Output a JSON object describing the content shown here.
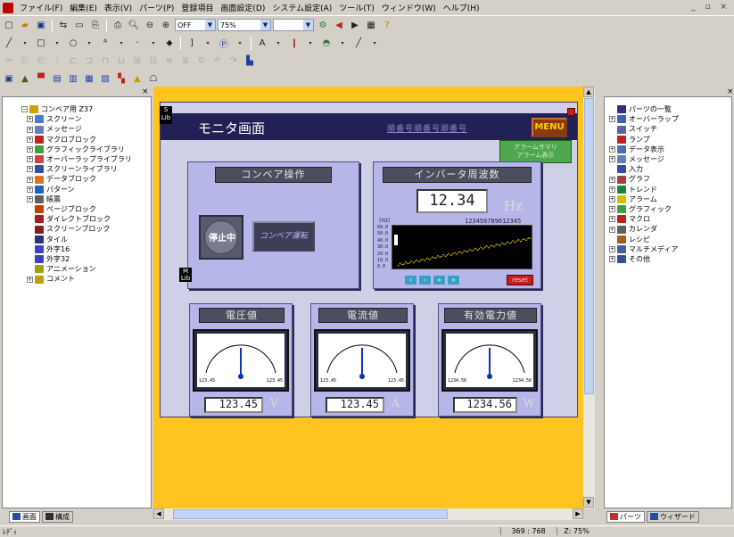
{
  "menu": {
    "items": [
      "ファイル(F)",
      "編集(E)",
      "表示(V)",
      "パーツ(P)",
      "登録項目",
      "画面設定(D)",
      "システム設定(A)",
      "ツール(T)",
      "ウィンドウ(W)",
      "ヘルプ(H)"
    ]
  },
  "toolbar": {
    "mode_label": "OFF",
    "zoom1": "75%",
    "zoom2": ""
  },
  "left_tree": {
    "root": "コンベア用 Z37",
    "items": [
      {
        "label": "スクリーン",
        "color": "#4a7ad0",
        "pm": "+"
      },
      {
        "label": "メッセージ",
        "color": "#6080c0",
        "pm": "+"
      },
      {
        "label": "マクロブロック",
        "color": "#c02020",
        "pm": "+"
      },
      {
        "label": "グラフィックライブラリ",
        "color": "#40a040",
        "pm": "+"
      },
      {
        "label": "オーバーラップライブラリ",
        "color": "#d04040",
        "pm": "+"
      },
      {
        "label": "スクリーンライブラリ",
        "color": "#3050a0",
        "pm": "+"
      },
      {
        "label": "データブロック",
        "color": "#e07020",
        "pm": "+"
      },
      {
        "label": "パターン",
        "color": "#2060c0",
        "pm": "+"
      },
      {
        "label": "帳票",
        "color": "#606060",
        "pm": "+"
      },
      {
        "label": "ページブロック",
        "color": "#c04000",
        "pm": ""
      },
      {
        "label": "ダイレクトブロック",
        "color": "#a02020",
        "pm": ""
      },
      {
        "label": "スクリーンブロック",
        "color": "#802020",
        "pm": ""
      },
      {
        "label": "タイル",
        "color": "#303080",
        "pm": ""
      },
      {
        "label": "外字16",
        "color": "#4040c0",
        "pm": ""
      },
      {
        "label": "外字32",
        "color": "#4040c0",
        "pm": ""
      },
      {
        "label": "アニメーション",
        "color": "#a0a000",
        "pm": ""
      },
      {
        "label": "コメント",
        "color": "#c0a000",
        "pm": "+"
      }
    ]
  },
  "left_tabs": {
    "tab1": "画面",
    "tab2": "構成"
  },
  "right_tree": {
    "items": [
      {
        "label": "パーツの一覧",
        "color": "#303080",
        "pm": ""
      },
      {
        "label": "オーバーラップ",
        "color": "#4060b0",
        "pm": "+"
      },
      {
        "label": "スイッチ",
        "color": "#6060a0",
        "pm": ""
      },
      {
        "label": "ランプ",
        "color": "#c02020",
        "pm": ""
      },
      {
        "label": "データ表示",
        "color": "#4070b0",
        "pm": "+"
      },
      {
        "label": "メッセージ",
        "color": "#6080c0",
        "pm": "+"
      },
      {
        "label": "入力",
        "color": "#3050a0",
        "pm": ""
      },
      {
        "label": "グラフ",
        "color": "#a04040",
        "pm": "+"
      },
      {
        "label": "トレンド",
        "color": "#208040",
        "pm": "+"
      },
      {
        "label": "アラーム",
        "color": "#d0c000",
        "pm": "+"
      },
      {
        "label": "グラフィック",
        "color": "#40a040",
        "pm": "+"
      },
      {
        "label": "マクロ",
        "color": "#c02020",
        "pm": "+"
      },
      {
        "label": "カレンダ",
        "color": "#606060",
        "pm": "+"
      },
      {
        "label": "レシピ",
        "color": "#a06020",
        "pm": ""
      },
      {
        "label": "マルチメディア",
        "color": "#4060a0",
        "pm": "+"
      },
      {
        "label": "その他",
        "color": "#305090",
        "pm": "+"
      }
    ]
  },
  "right_tabs": {
    "tab1": "パーツ",
    "tab2": "ウィザード"
  },
  "screen": {
    "title": "モニタ画面",
    "subtitle": "順番号順番号順番号",
    "menu_button": "MENU",
    "tag": "S\nLib",
    "tag2": "M\nLib",
    "overlay_note": "アラームサマリ\nアラーム表示",
    "conveyor": {
      "title": "コンベア操作",
      "stop": "停止中",
      "run": "コンベア運転"
    },
    "inverter": {
      "title": "インバータ周波数",
      "value": "12.34",
      "unit": "Hz",
      "hz_label": "(Hz)",
      "scale_digits": "123456789012345",
      "y_ticks": [
        "60.0",
        "50.0",
        "40.0",
        "30.0",
        "20.0",
        "10.0",
        "0.0"
      ],
      "reset": "reset"
    },
    "voltage": {
      "title": "電圧値",
      "value": "123.45",
      "unit": "V",
      "min": "123.45",
      "max": "123.45"
    },
    "current": {
      "title": "電流値",
      "value": "123.45",
      "unit": "A",
      "min": "123.45",
      "max": "123.45"
    },
    "power": {
      "title": "有効電力値",
      "value": "1234.56",
      "unit": "W",
      "min": "1234.56",
      "max": "1234.56"
    }
  },
  "status": {
    "left": "ﾚﾃﾞｨ",
    "coords": "369 : 768",
    "zoom": "Z: 75%"
  },
  "colors": {
    "canvas": "#ffc41f",
    "screen_header": "#212156",
    "panel": "#b6b6e8"
  }
}
